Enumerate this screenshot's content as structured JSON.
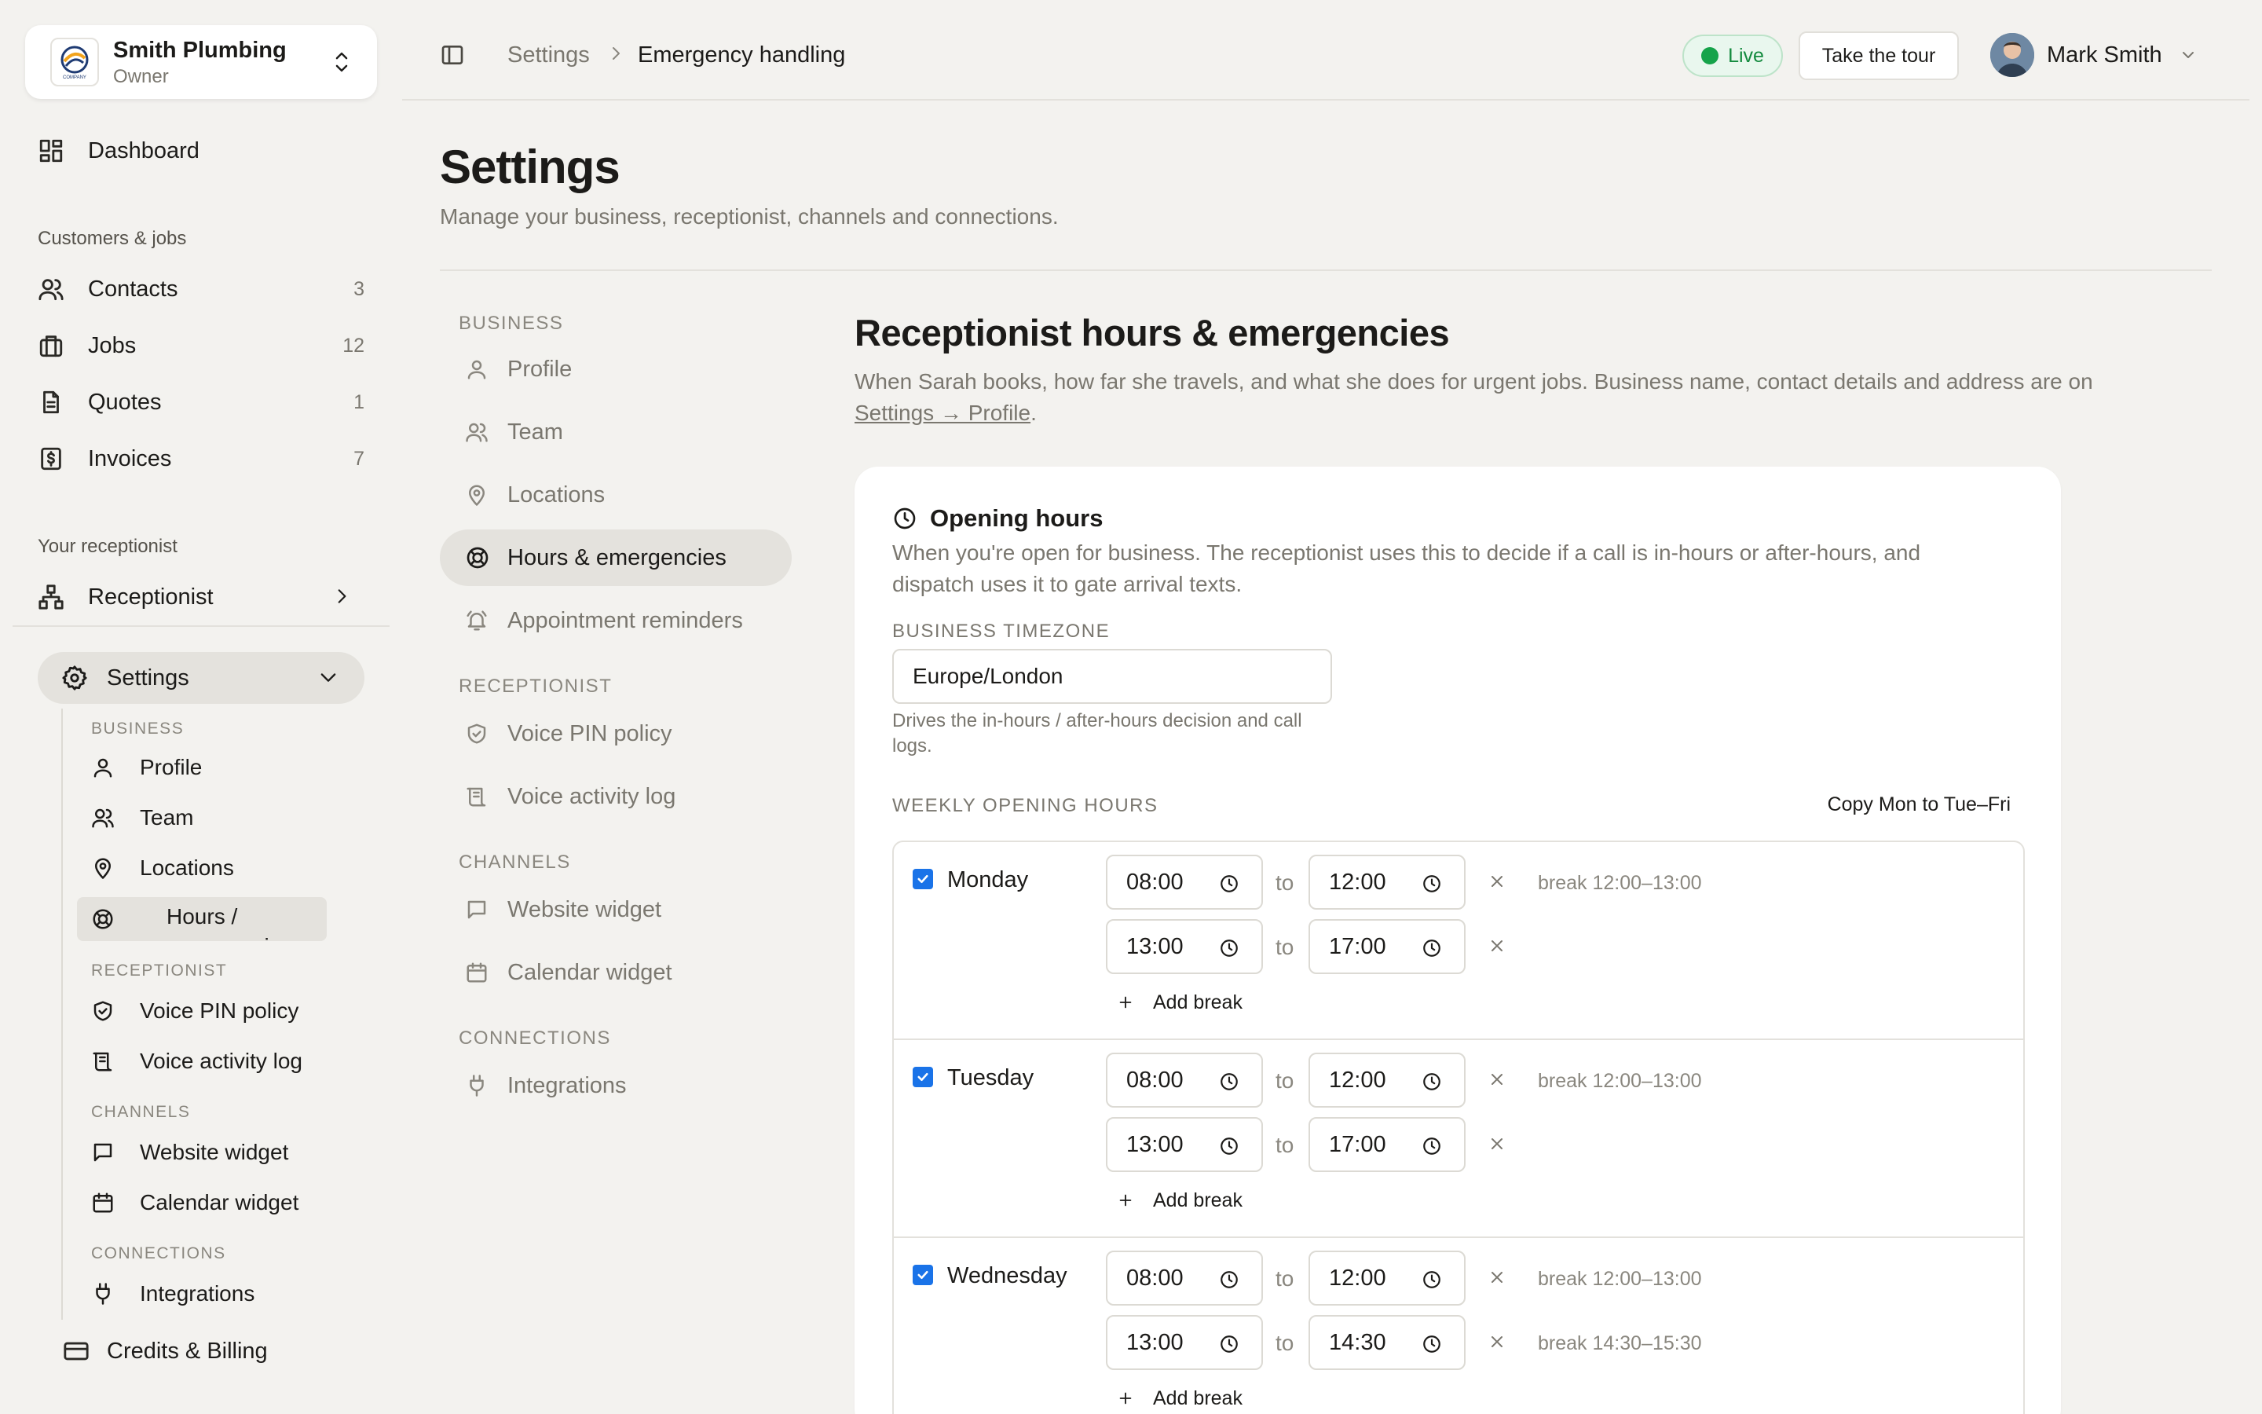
{
  "org": {
    "name": "Smith Plumbing",
    "role": "Owner",
    "logo_text": "COMPANY"
  },
  "sidebar": {
    "dashboard": "Dashboard",
    "section_customers": "Customers & jobs",
    "items": [
      {
        "label": "Contacts",
        "count": "3"
      },
      {
        "label": "Jobs",
        "count": "12"
      },
      {
        "label": "Quotes",
        "count": "1"
      },
      {
        "label": "Invoices",
        "count": "7"
      }
    ],
    "section_receptionist": "Your receptionist",
    "receptionist": "Receptionist",
    "settings": "Settings",
    "sub": {
      "business": "BUSINESS",
      "profile": "Profile",
      "team": "Team",
      "locations": "Locations",
      "hours": "Hours / emergencies",
      "receptionist": "RECEPTIONIST",
      "voice_pin": "Voice PIN policy",
      "voice_log": "Voice activity log",
      "channels": "CHANNELS",
      "website_widget": "Website widget",
      "calendar_widget": "Calendar widget",
      "connections": "CONNECTIONS",
      "integrations": "Integrations"
    },
    "credits": "Credits & Billing"
  },
  "topbar": {
    "crumb_parent": "Settings",
    "crumb_current": "Emergency handling",
    "live": "Live",
    "tour": "Take the tour",
    "user": "Mark Smith"
  },
  "page": {
    "title": "Settings",
    "subtitle": "Manage your business, receptionist, channels and connections."
  },
  "subnav": {
    "business": "BUSINESS",
    "profile": "Profile",
    "team": "Team",
    "locations": "Locations",
    "hours": "Hours & emergencies",
    "reminders": "Appointment reminders",
    "receptionist": "RECEPTIONIST",
    "voice_pin": "Voice PIN policy",
    "voice_log": "Voice activity log",
    "channels": "CHANNELS",
    "website_widget": "Website widget",
    "calendar_widget": "Calendar widget",
    "connections": "CONNECTIONS",
    "integrations": "Integrations"
  },
  "section": {
    "title": "Receptionist hours & emergencies",
    "desc": "When Sarah books, how far she travels, and what she does for urgent jobs. Business name, contact details and address are on ",
    "link": "Settings → Profile",
    "desc_end": "."
  },
  "hours_card": {
    "title": "Opening hours",
    "desc": "When you're open for business. The receptionist uses this to decide if a call is in-hours or after-hours, and dispatch uses it to gate arrival texts.",
    "tz_label": "BUSINESS TIMEZONE",
    "tz_value": "Europe/London",
    "tz_help": "Drives the in-hours / after-hours decision and call logs.",
    "weekly_label": "WEEKLY OPENING HOURS",
    "copy": "Copy Mon to Tue–Fri",
    "to": "to",
    "add_break": "Add break",
    "days": [
      {
        "name": "Monday",
        "checked": true,
        "slots": [
          {
            "start": "08:00",
            "end": "12:00"
          },
          {
            "start": "13:00",
            "end": "17:00"
          }
        ],
        "breaks": [
          "break 12:00–13:00"
        ]
      },
      {
        "name": "Tuesday",
        "checked": true,
        "slots": [
          {
            "start": "08:00",
            "end": "12:00"
          },
          {
            "start": "13:00",
            "end": "17:00"
          }
        ],
        "breaks": [
          "break 12:00–13:00"
        ]
      },
      {
        "name": "Wednesday",
        "checked": true,
        "slots": [
          {
            "start": "08:00",
            "end": "12:00"
          },
          {
            "start": "13:00",
            "end": "14:30"
          }
        ],
        "breaks": [
          "break 12:00–13:00",
          "break 14:30–15:30"
        ]
      }
    ]
  }
}
